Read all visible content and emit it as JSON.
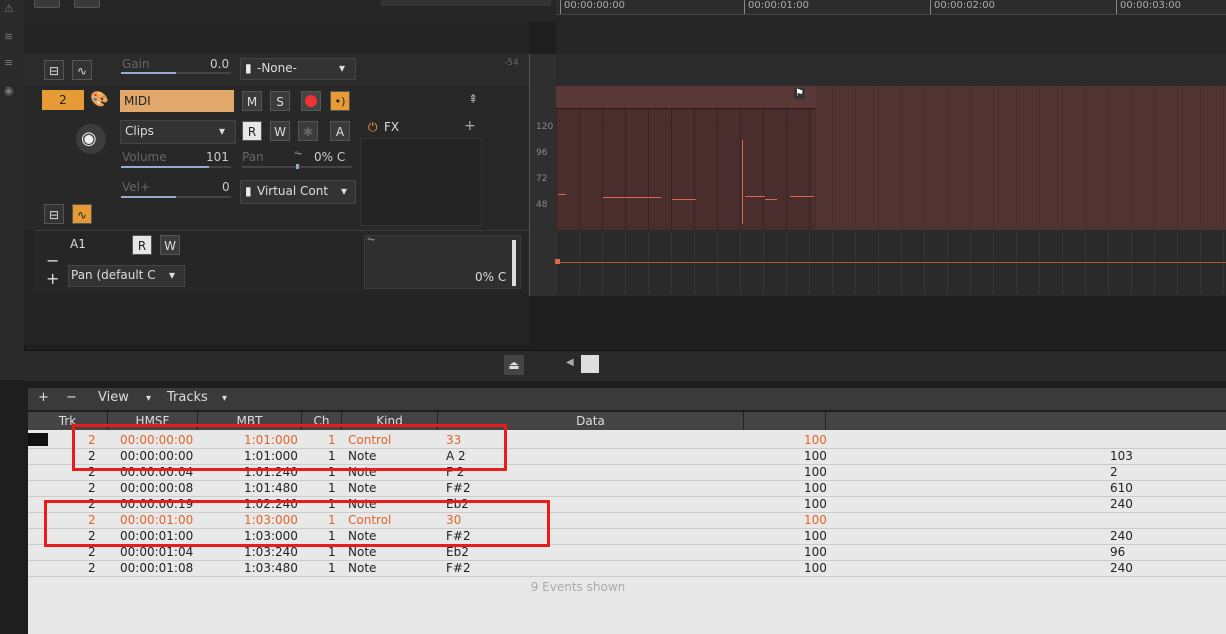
{
  "timeline": {
    "ruler_labels": [
      "00:00:00:00",
      "00:00:01:00",
      "00:00:02:00",
      "00:00:03:00"
    ]
  },
  "track_top": {
    "gain_label": "Gain",
    "gain_value": "0.0",
    "output": "-None-",
    "meter": "-54"
  },
  "track": {
    "number": "2",
    "name": "MIDI",
    "buttons": {
      "mute": "M",
      "solo": "S",
      "read": "R",
      "write": "W",
      "auto": "A"
    },
    "input_mode": "Clips",
    "fx_label": "FX",
    "volume_label": "Volume",
    "volume_value": "101",
    "pan_label": "Pan",
    "pan_value": "0% C",
    "vel_label": "Vel+",
    "vel_value": "0",
    "output": "Virtual Cont"
  },
  "automation_lane": {
    "name": "A1",
    "read": "R",
    "write": "W",
    "param": "Pan (default C",
    "value": "0% C"
  },
  "vruler": [
    "120",
    "96",
    "72",
    "48"
  ],
  "event_list": {
    "toolbar": {
      "add": "+",
      "remove": "−",
      "view": "View",
      "tracks": "Tracks"
    },
    "columns": [
      "Trk",
      "HMSF",
      "MBT",
      "Ch",
      "Kind",
      "Data"
    ],
    "rows": [
      {
        "trk": "2",
        "hmsf": "00:00:00:00",
        "mbt": "1:01:000",
        "ch": "1",
        "kind": "Control",
        "d1": "33",
        "d2": "100",
        "d3": "",
        "ctrl": true
      },
      {
        "trk": "2",
        "hmsf": "00:00:00:00",
        "mbt": "1:01:000",
        "ch": "1",
        "kind": "Note",
        "d1": "A 2",
        "d2": "100",
        "d3": "103",
        "ctrl": false
      },
      {
        "trk": "2",
        "hmsf": "00:00:00:04",
        "mbt": "1:01:240",
        "ch": "1",
        "kind": "Note",
        "d1": "F 2",
        "d2": "100",
        "d3": "2",
        "ctrl": false
      },
      {
        "trk": "2",
        "hmsf": "00:00:00:08",
        "mbt": "1:01:480",
        "ch": "1",
        "kind": "Note",
        "d1": "F#2",
        "d2": "100",
        "d3": "610",
        "ctrl": false
      },
      {
        "trk": "2",
        "hmsf": "00:00:00:19",
        "mbt": "1:02:240",
        "ch": "1",
        "kind": "Note",
        "d1": "Eb2",
        "d2": "100",
        "d3": "240",
        "ctrl": false
      },
      {
        "trk": "2",
        "hmsf": "00:00:01:00",
        "mbt": "1:03:000",
        "ch": "1",
        "kind": "Control",
        "d1": "30",
        "d2": "100",
        "d3": "",
        "ctrl": true
      },
      {
        "trk": "2",
        "hmsf": "00:00:01:00",
        "mbt": "1:03:000",
        "ch": "1",
        "kind": "Note",
        "d1": "F#2",
        "d2": "100",
        "d3": "240",
        "ctrl": false
      },
      {
        "trk": "2",
        "hmsf": "00:00:01:04",
        "mbt": "1:03:240",
        "ch": "1",
        "kind": "Note",
        "d1": "Eb2",
        "d2": "100",
        "d3": "96",
        "ctrl": false
      },
      {
        "trk": "2",
        "hmsf": "00:00:01:08",
        "mbt": "1:03:480",
        "ch": "1",
        "kind": "Note",
        "d1": "F#2",
        "d2": "100",
        "d3": "240",
        "ctrl": false
      }
    ],
    "footer": "9 Events shown"
  }
}
